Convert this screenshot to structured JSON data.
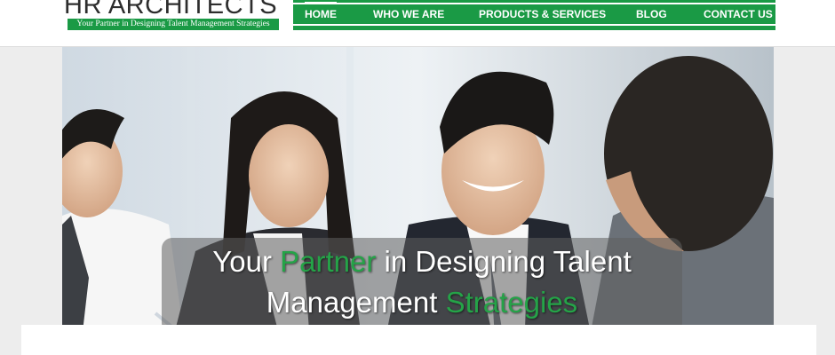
{
  "brand": {
    "name": "HR ARCHITECTS",
    "tagline": "Your Partner in Designing Talent Management Strategies"
  },
  "nav": {
    "items": [
      {
        "label": "HOME",
        "active": true
      },
      {
        "label": "WHO WE ARE",
        "active": false
      },
      {
        "label": "PRODUCTS & SERVICES",
        "active": false
      },
      {
        "label": "BLOG",
        "active": false
      },
      {
        "label": "CONTACT US",
        "active": false
      }
    ]
  },
  "hero": {
    "line1": {
      "pre": "Your ",
      "highlight": "Partner",
      "post": " in Designing Talent"
    },
    "line2": {
      "pre": "Management ",
      "highlight": "Strategies"
    }
  },
  "colors": {
    "brand_green": "#1a9a45",
    "highlight_green": "#25a348",
    "page_bg": "#ededed"
  }
}
